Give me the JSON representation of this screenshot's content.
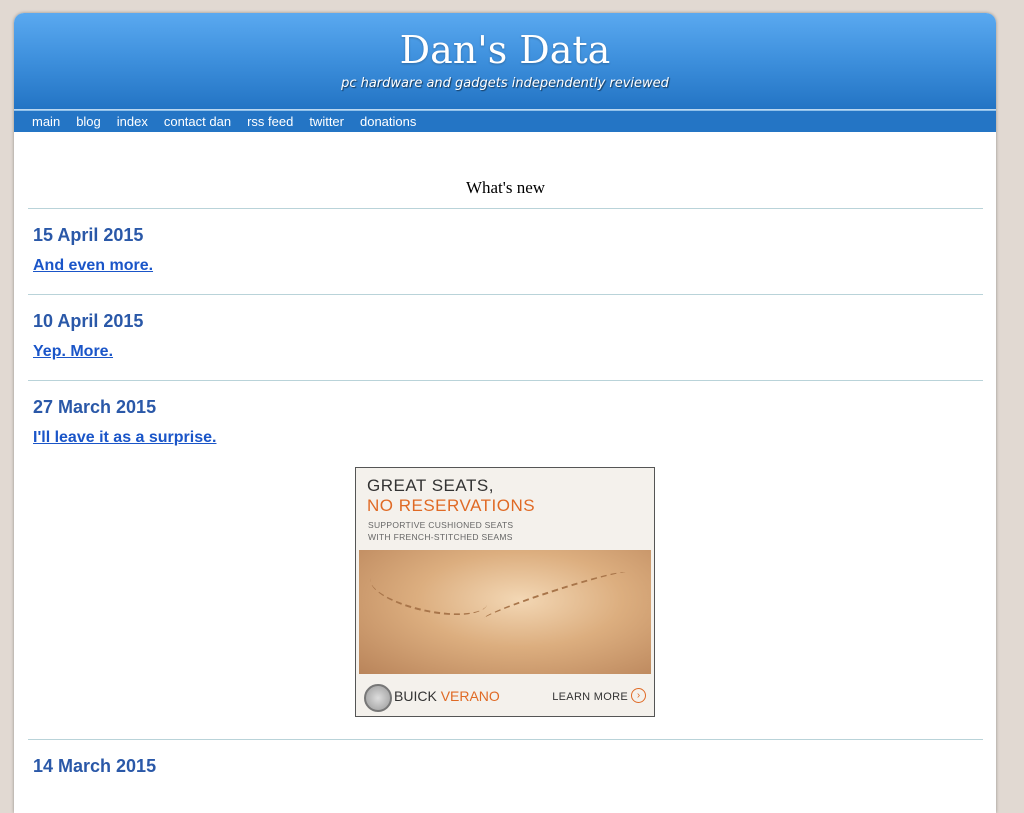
{
  "site": {
    "title": "Dan's Data",
    "tagline": "pc hardware and gadgets independently reviewed"
  },
  "nav": {
    "items": [
      {
        "label": "main"
      },
      {
        "label": "blog"
      },
      {
        "label": "index"
      },
      {
        "label": "contact dan"
      },
      {
        "label": "rss feed"
      },
      {
        "label": "twitter"
      },
      {
        "label": "donations"
      }
    ]
  },
  "main": {
    "heading": "What's new",
    "entries": [
      {
        "date": "15 April 2015",
        "link": "And even more."
      },
      {
        "date": "10 April 2015",
        "link": "Yep. More."
      },
      {
        "date": "27 March 2015",
        "link": "I'll leave it as a surprise."
      },
      {
        "date": "14 March 2015",
        "link": ""
      }
    ]
  },
  "ad": {
    "line1": "GREAT SEATS,",
    "line2": "NO RESERVATIONS",
    "sub1": "SUPPORTIVE CUSHIONED SEATS",
    "sub2": "WITH FRENCH-STITCHED SEAMS",
    "brand": "BUICK",
    "model": "VERANO",
    "cta": "LEARN MORE",
    "accent_color": "#e06a25"
  },
  "colors": {
    "header_top": "#5aa9f0",
    "header_bottom": "#2374c4",
    "date_color": "#2a58a8",
    "link_color": "#1a55c8"
  }
}
